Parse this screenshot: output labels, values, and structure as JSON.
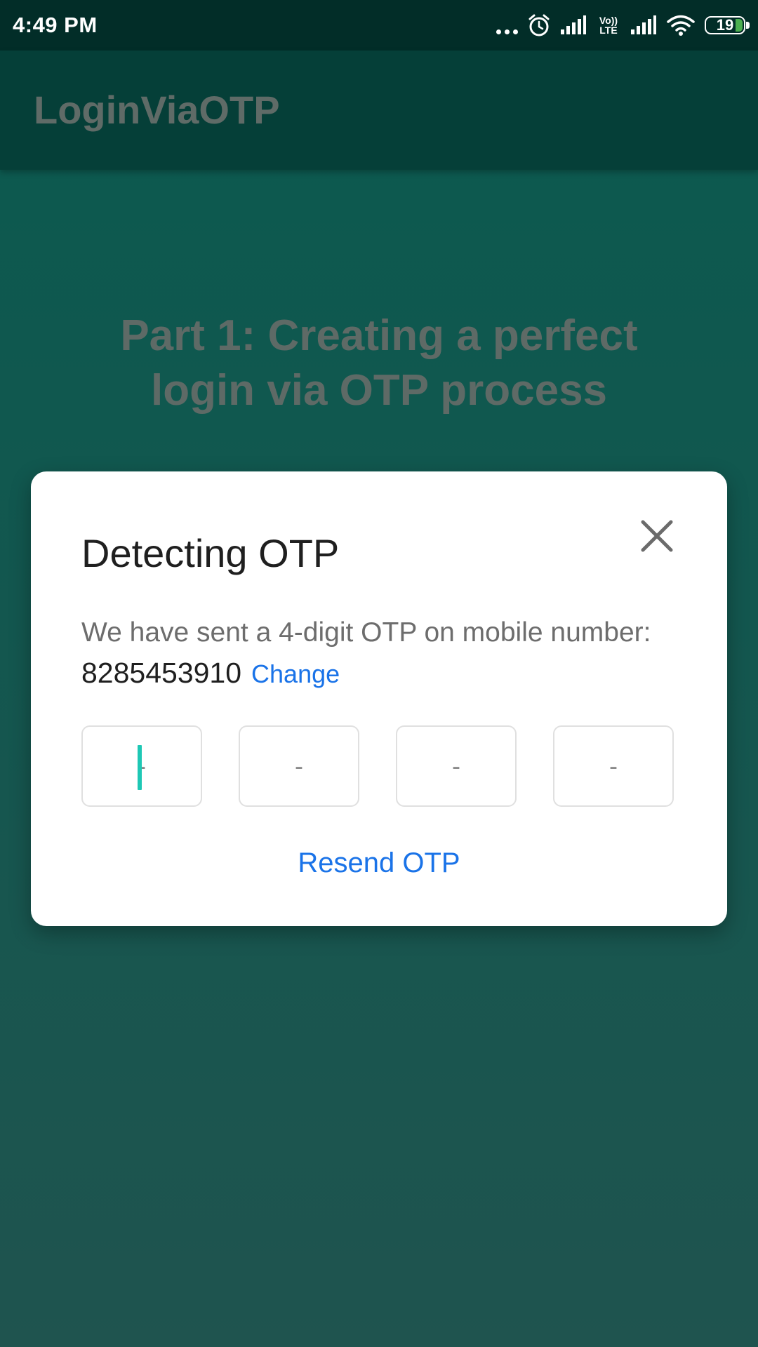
{
  "status_bar": {
    "time": "4:49 PM",
    "network_label": "Vo)) LTE",
    "battery_level": "19",
    "icons": [
      "more-dots-icon",
      "alarm-icon",
      "signal-icon",
      "volte-icon",
      "signal-icon",
      "wifi-icon",
      "battery-icon"
    ]
  },
  "app_bar": {
    "title": "LoginViaOTP"
  },
  "background": {
    "heading": "Part 1: Creating a perfect login via OTP process"
  },
  "dialog": {
    "title": "Detecting OTP",
    "close_icon": "close-icon",
    "message": "We have sent a 4-digit OTP on mobile number:",
    "phone_number": "8285453910",
    "change_label": "Change",
    "otp_fields": [
      {
        "placeholder": "-",
        "value": ""
      },
      {
        "placeholder": "-",
        "value": ""
      },
      {
        "placeholder": "-",
        "value": ""
      },
      {
        "placeholder": "-",
        "value": ""
      }
    ],
    "resend_label": "Resend OTP"
  },
  "colors": {
    "accent": "#1a73e8",
    "cursor": "#1ec8b5",
    "status_bar": "#022d28",
    "app_bar": "#053f38"
  }
}
